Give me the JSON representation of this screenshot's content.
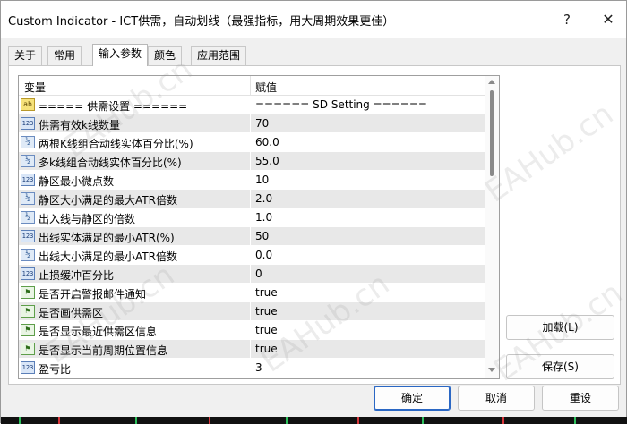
{
  "window": {
    "title": "Custom Indicator - ICT供需，自动划线（最强指标，用大周期效果更佳）",
    "help_label": "?",
    "close_label": "✕"
  },
  "tabs": [
    {
      "label": "关于"
    },
    {
      "label": "常用"
    },
    {
      "label": "输入参数",
      "active": true
    },
    {
      "label": "颜色"
    },
    {
      "label": "应用范围"
    }
  ],
  "grid": {
    "col_variable": "变量",
    "col_value": "赋值",
    "rows": [
      {
        "icon": "ab",
        "name": "===== 供需设置 ======",
        "value": "====== SD Setting ======"
      },
      {
        "icon": "123",
        "name": "供需有效k线数量",
        "value": "70"
      },
      {
        "icon": "1/2",
        "name": "两根K线组合动线实体百分比(%)",
        "value": "60.0"
      },
      {
        "icon": "1/2",
        "name": "多k线组合动线实体百分比(%)",
        "value": "55.0"
      },
      {
        "icon": "123",
        "name": "静区最小微点数",
        "value": "10"
      },
      {
        "icon": "1/2",
        "name": "静区大小满足的最大ATR倍数",
        "value": "2.0"
      },
      {
        "icon": "1/2",
        "name": "出入线与静区的倍数",
        "value": "1.0"
      },
      {
        "icon": "123",
        "name": "出线实体满足的最小ATR(%)",
        "value": "50"
      },
      {
        "icon": "1/2",
        "name": "出线大小满足的最小ATR倍数",
        "value": "0.0"
      },
      {
        "icon": "123",
        "name": "止损缓冲百分比",
        "value": "0"
      },
      {
        "icon": "flag",
        "name": "是否开启警报邮件通知",
        "value": "true"
      },
      {
        "icon": "flag",
        "name": "是否画供需区",
        "value": "true"
      },
      {
        "icon": "flag",
        "name": "是否显示最近供需区信息",
        "value": "true"
      },
      {
        "icon": "flag",
        "name": "是否显示当前周期位置信息",
        "value": "true"
      },
      {
        "icon": "123",
        "name": "盈亏比",
        "value": "3"
      }
    ]
  },
  "side_buttons": {
    "load": "加载(L)",
    "save": "保存(S)"
  },
  "footer_buttons": {
    "ok": "确定",
    "cancel": "取消",
    "reset": "重设"
  },
  "watermark": "EAHub.cn",
  "colors": {
    "accent": "#2a67c4",
    "row_alt": "#e8e8e8"
  }
}
